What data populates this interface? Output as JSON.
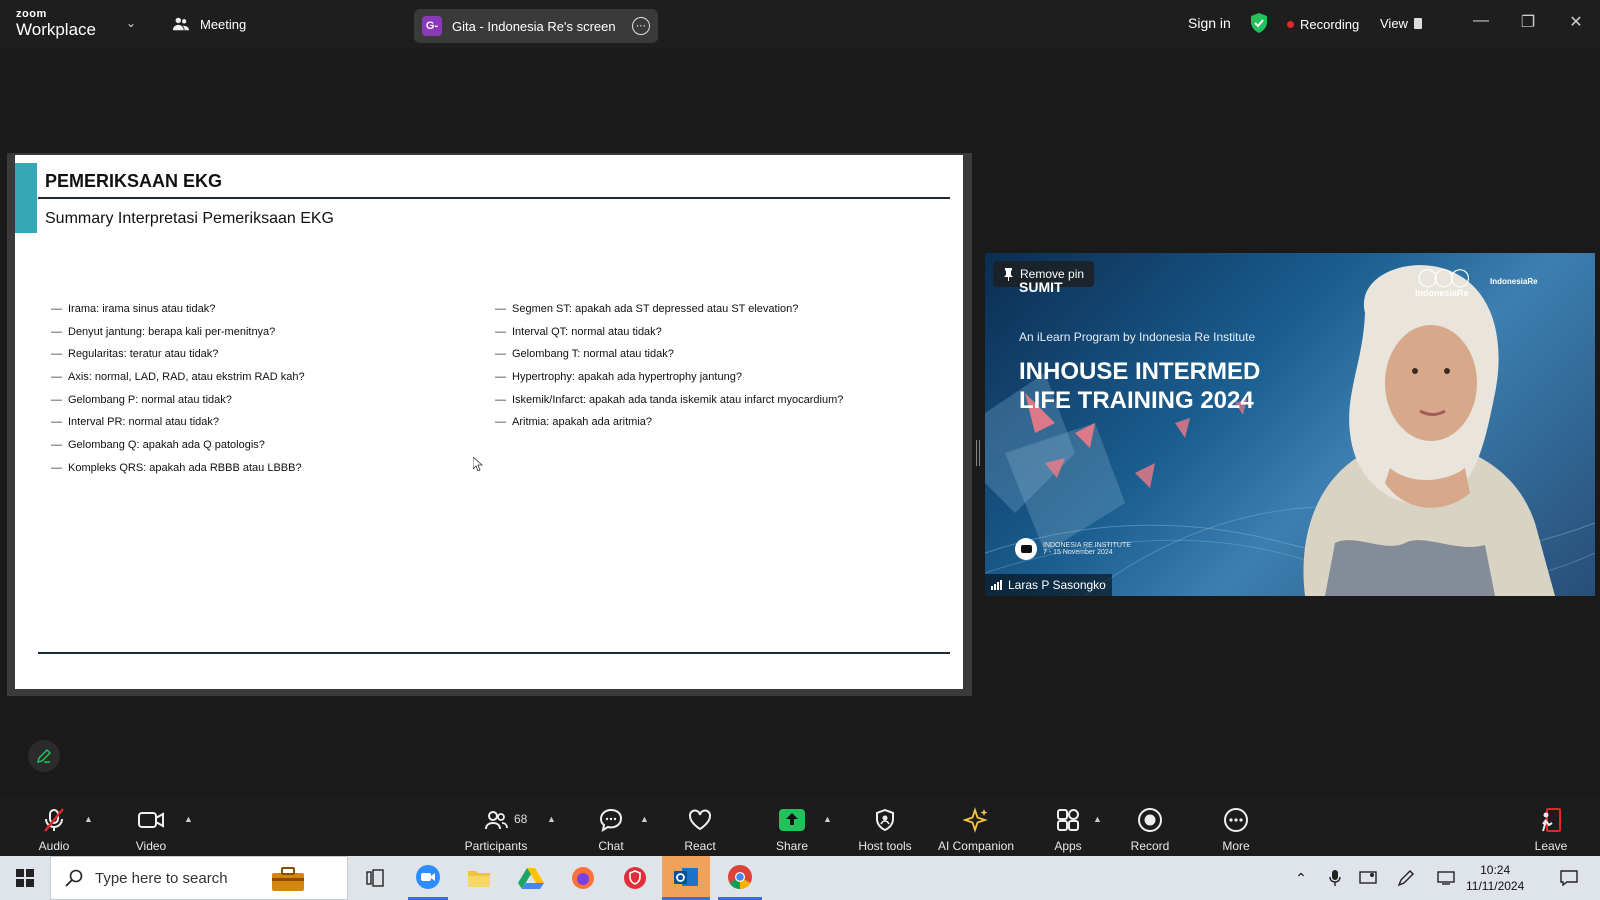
{
  "titlebar": {
    "logo_small": "zoom",
    "logo_main": "Workplace",
    "meeting_label": "Meeting",
    "share_badge": "G-",
    "share_title": "Gita - Indonesia Re's screen",
    "sign_in": "Sign in",
    "recording": "Recording",
    "view": "View"
  },
  "slide": {
    "title": "PEMERIKSAAN EKG",
    "subtitle": "Summary Interpretasi Pemeriksaan EKG",
    "col1": [
      "Irama: irama sinus atau tidak?",
      "Denyut jantung: berapa kali per-menitnya?",
      "Regularitas: teratur atau tidak?",
      "Axis: normal, LAD, RAD, atau ekstrim RAD kah?",
      "Gelombang P: normal atau tidak?",
      "Interval PR: normal atau tidak?",
      "Gelombang Q: apakah ada Q patologis?",
      "Kompleks QRS: apakah ada RBBB atau LBBB?"
    ],
    "col2": [
      "Segmen ST: apakah ada ST depressed atau ST elevation?",
      "Interval QT: normal atau tidak?",
      "Gelombang T: normal atau tidak?",
      "Hypertrophy: apakah ada hypertrophy jantung?",
      "Iskemik/Infarct: apakah ada tanda iskemik atau infarct myocardium?",
      "Aritmia: apakah ada aritmia?"
    ],
    "dash": "—"
  },
  "video": {
    "remove_pin": "Remove pin",
    "sumit": "SUMIT",
    "ire_logo": "IndonesiaRe",
    "ire_inst": "IndonesiaRe",
    "program": "An iLearn Program by Indonesia Re Institute",
    "headline_1": "INHOUSE INTERMED",
    "headline_2": "LIFE TRAINING 2024",
    "inst_name": "INDONESIA RE INSTITUTE",
    "inst_dates": "7 - 15 November 2024",
    "participant": "Laras P Sasongko"
  },
  "toolbar": {
    "audio": "Audio",
    "video": "Video",
    "participants": "Participants",
    "participants_count": "68",
    "chat": "Chat",
    "react": "React",
    "share": "Share",
    "host_tools": "Host tools",
    "ai_companion": "AI Companion",
    "apps": "Apps",
    "record": "Record",
    "more": "More",
    "leave": "Leave"
  },
  "taskbar": {
    "search_placeholder": "Type here to search",
    "time": "10:24",
    "date": "11/11/2024"
  },
  "colors": {
    "slide_accent": "#35a7b6",
    "share_green": "#1fc25b",
    "recording_red": "#e02828",
    "badge_purple": "#8a3ab9"
  }
}
